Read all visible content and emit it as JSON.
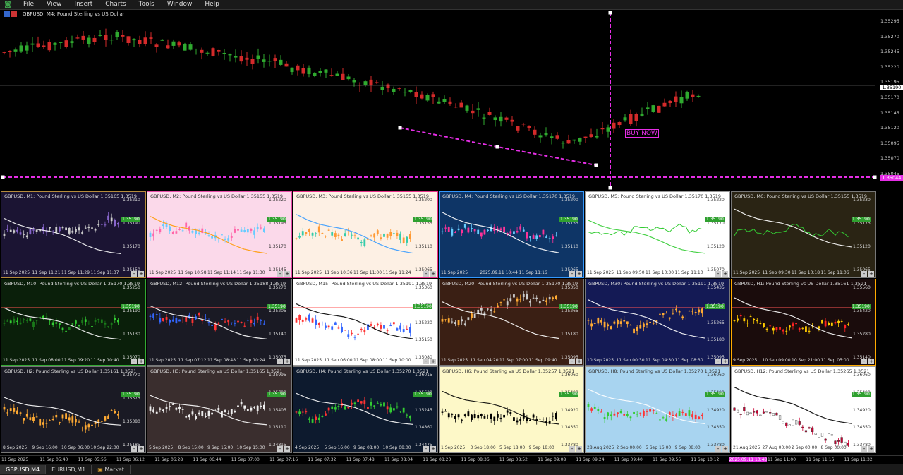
{
  "menu": [
    "File",
    "View",
    "Insert",
    "Charts",
    "Tools",
    "Window",
    "Help"
  ],
  "main_chart": {
    "title": "GBPUSD, M4:  Pound Sterling vs US Dollar",
    "prices": [
      "1.35295",
      "1.35270",
      "1.35245",
      "1.35220",
      "1.35195",
      "1.35170",
      "1.35145",
      "1.35120",
      "1.35095",
      "1.35070",
      "1.35045"
    ],
    "current_price": "1.35190",
    "line_price": "1.35044",
    "label": "BUY NOW"
  },
  "tiles": [
    {
      "title": "GBPUSD, M1:  Pound Sterling vs US Dollar  1.35165 1.3519",
      "bg": "#1b1433",
      "fg": "#ddd",
      "border": "#b58b3c",
      "prices": [
        "1.35210",
        "1.35190",
        "1.35170",
        "1.35150"
      ],
      "cur": "1.35190",
      "times": [
        "11 Sep 2025",
        "11 Sep 11:21",
        "11 Sep 11:29",
        "11 Sep 11:37"
      ],
      "up": "#cccccc",
      "dn": "#8866cc",
      "ma": "#ffffff"
    },
    {
      "title": "GBPUSD, M2:  Pound Sterling vs US Dollar  1.35155 1.3519",
      "bg": "#fbd9ea",
      "fg": "#333",
      "border": "#e64da8",
      "prices": [
        "1.35220",
        "1.35195",
        "1.35170",
        "1.35145"
      ],
      "cur": "1.35190",
      "times": [
        "11 Sep 2025",
        "11 Sep 10:58",
        "11 Sep 11:14",
        "11 Sep 11:30"
      ],
      "up": "#66ccff",
      "dn": "#ff66aa",
      "ma": "#ff9900"
    },
    {
      "title": "GBPUSD, M3:  Pound Sterling vs US Dollar  1.35155 1.3519",
      "bg": "#fdf0e4",
      "fg": "#333",
      "border": "#e8328a",
      "prices": [
        "1.35200",
        "1.35155",
        "1.35110",
        "1.35065"
      ],
      "cur": "1.35190",
      "times": [
        "11 Sep 2025",
        "11 Sep 10:36",
        "11 Sep 11:00",
        "11 Sep 11:24"
      ],
      "up": "#33ccaa",
      "dn": "#ff9933",
      "ma": "#3399ff"
    },
    {
      "title": "GBPUSD, M4:  Pound Sterling vs US Dollar  1.35170 1.3519",
      "bg": "#0e3566",
      "fg": "#ddd",
      "border": "#3399ff",
      "prices": [
        "1.35200",
        "1.35155",
        "1.35110",
        "1.35065"
      ],
      "cur": "1.35190",
      "times": [
        "11 Sep 2025",
        "2025.09.11 10:44",
        "11 Sep 11:16"
      ],
      "up": "#66ccff",
      "dn": "#ff3399",
      "ma": "#ffffff"
    },
    {
      "title": "GBPUSD, M5:  Pound Sterling vs US Dollar  1.35170 1.3519",
      "bg": "#ffffff",
      "fg": "#333",
      "border": "#999",
      "prices": [
        "1.35220",
        "1.35170",
        "1.35120",
        "1.35070"
      ],
      "cur": "1.35190",
      "times": [
        "11 Sep 2025",
        "11 Sep 09:50",
        "11 Sep 10:30",
        "11 Sep 11:10"
      ],
      "up": "#33cc33",
      "dn": "#33cc33",
      "ma": "#33cc33"
    },
    {
      "title": "GBPUSD, M6:  Pound Sterling vs US Dollar  1.35155 1.3519",
      "bg": "#2a2414",
      "fg": "#ddd",
      "border": "#777",
      "prices": [
        "1.35230",
        "1.35175",
        "1.35120",
        "1.35065"
      ],
      "cur": "1.35190",
      "times": [
        "11 Sep 2025",
        "11 Sep 09:30",
        "11 Sep 10:18",
        "11 Sep 11:06"
      ],
      "up": "#33cc33",
      "dn": "#33cc33",
      "ma": "#ffffff"
    },
    {
      "title": "GBPUSD, M10:  Pound Sterling vs US Dollar  1.35170 1.3519",
      "bg": "#0a1f0a",
      "fg": "#ddd",
      "border": "#33aa33",
      "prices": [
        "1.35250",
        "1.35190",
        "1.35130",
        "1.35070"
      ],
      "cur": "1.35190",
      "times": [
        "11 Sep 2025",
        "11 Sep 08:00",
        "11 Sep 09:20",
        "11 Sep 10:40"
      ],
      "up": "#33cc33",
      "dn": "#1a7a1a",
      "ma": "#ffffff"
    },
    {
      "title": "GBPUSD, M12:  Pound Sterling vs US Dollar  1.35188 1.3519",
      "bg": "#1a1a24",
      "fg": "#ddd",
      "border": "#777",
      "prices": [
        "1.35270",
        "1.35205",
        "1.35140",
        "1.35075"
      ],
      "cur": "1.35190",
      "times": [
        "11 Sep 2025",
        "11 Sep 07:12",
        "11 Sep 08:48",
        "11 Sep 10:24"
      ],
      "up": "#3366ff",
      "dn": "#ff3333",
      "ma": "#ffffff"
    },
    {
      "title": "GBPUSD, M15:  Pound Sterling vs US Dollar  1.35191 1.3519",
      "bg": "#ffffff",
      "fg": "#333",
      "border": "#999",
      "prices": [
        "1.35360",
        "1.35290",
        "1.35220",
        "1.35150",
        "1.35080"
      ],
      "cur": "1.35190",
      "times": [
        "11 Sep 2025",
        "11 Sep 06:00",
        "11 Sep 08:00",
        "11 Sep 10:00"
      ],
      "up": "#3366ff",
      "dn": "#ff3333",
      "ma": "#000000"
    },
    {
      "title": "GBPUSD, M20:  Pound Sterling vs US Dollar  1.35170 1.3519",
      "bg": "#3a1f14",
      "fg": "#ddd",
      "border": "#777",
      "prices": [
        "1.35350",
        "1.35265",
        "1.35180",
        "1.35095"
      ],
      "cur": "1.35190",
      "times": [
        "11 Sep 2025",
        "11 Sep 04:20",
        "11 Sep 07:00",
        "11 Sep 09:40"
      ],
      "up": "#cccccc",
      "dn": "#ffaa33",
      "ma": "#ffffff"
    },
    {
      "title": "GBPUSD, M30:  Pound Sterling vs US Dollar  1.35191 1.3519",
      "bg": "#141a55",
      "fg": "#ddd",
      "border": "#777",
      "prices": [
        "1.35435",
        "1.35350",
        "1.35265",
        "1.35180",
        "1.35095"
      ],
      "cur": "1.35190",
      "times": [
        "10 Sep 2025",
        "11 Sep 00:30",
        "11 Sep 04:30",
        "11 Sep 08:30"
      ],
      "up": "#ffaa33",
      "dn": "#ffaa33",
      "ma": "#ffffff"
    },
    {
      "title": "GBPUSD, H1:  Pound Sterling vs US Dollar  1.35161 1.3521",
      "bg": "#1a0c0c",
      "fg": "#ddd",
      "border": "#ffaa00",
      "prices": [
        "1.35560",
        "1.35420",
        "1.35280",
        "1.35140"
      ],
      "cur": "1.35190",
      "times": [
        "9 Sep 2025",
        "10 Sep 09:00",
        "10 Sep 21:00",
        "11 Sep 05:00"
      ],
      "up": "#ffcc00",
      "dn": "#ff2222",
      "ma": "#ffffff"
    },
    {
      "title": "GBPUSD, H2:  Pound Sterling vs US Dollar  1.35161 1.3521",
      "bg": "#1a1a24",
      "fg": "#ddd",
      "border": "#777",
      "prices": [
        "1.35770",
        "1.35575",
        "1.35380",
        "1.35185"
      ],
      "cur": "1.35190",
      "times": [
        "8 Sep 2025",
        "9 Sep 16:00",
        "10 Sep 06:00",
        "10 Sep 22:00"
      ],
      "up": "#ffaa33",
      "dn": "#ffaa33",
      "ma": "#ffffff"
    },
    {
      "title": "GBPUSD, H3:  Pound Sterling vs US Dollar  1.35165 1.3521",
      "bg": "#3a2e2e",
      "fg": "#ddd",
      "border": "#777",
      "prices": [
        "1.35995",
        "1.35700",
        "1.35405",
        "1.35110",
        "1.34815"
      ],
      "cur": "1.35190",
      "times": [
        "5 Sep 2025",
        "8 Sep 15:00",
        "9 Sep 15:00",
        "10 Sep 15:00"
      ],
      "up": "#eeeeee",
      "dn": "#eeeeee",
      "ma": "#ffffff"
    },
    {
      "title": "GBPUSD, H4:  Pound Sterling vs US Dollar  1.35270 1.3521",
      "bg": "#0d1a2e",
      "fg": "#ddd",
      "border": "#777",
      "prices": [
        "1.36015",
        "1.35630",
        "1.35245",
        "1.34860",
        "1.34475"
      ],
      "cur": "1.35190",
      "times": [
        "4 Sep 2025",
        "5 Sep 16:00",
        "9 Sep 08:00",
        "10 Sep 08:00"
      ],
      "up": "#33cc33",
      "dn": "#ff3333",
      "ma": "#ffffff"
    },
    {
      "title": "GBPUSD, H6:  Pound Sterling vs US Dollar  1.35257 1.3521",
      "bg": "#fdf8c8",
      "fg": "#333",
      "border": "#999",
      "prices": [
        "1.36060",
        "1.35490",
        "1.34920",
        "1.34350",
        "1.33780"
      ],
      "cur": "1.35190",
      "times": [
        "1 Sep 2025",
        "3 Sep 18:00",
        "5 Sep 18:00",
        "9 Sep 18:00"
      ],
      "up": "#000000",
      "dn": "#000000",
      "ma": "#000000"
    },
    {
      "title": "GBPUSD, H8:  Pound Sterling vs US Dollar  1.35270 1.3521",
      "bg": "#a8d4f0",
      "fg": "#333",
      "border": "#999",
      "prices": [
        "1.36060",
        "1.35490",
        "1.34920",
        "1.34350",
        "1.33780"
      ],
      "cur": "1.35190",
      "times": [
        "28 Aug 2025",
        "2 Sep 00:00",
        "5 Sep 16:00",
        "9 Sep 08:00"
      ],
      "up": "#33cc33",
      "dn": "#ff3333",
      "ma": "#ffffff"
    },
    {
      "title": "GBPUSD, H12:  Pound Sterling vs US Dollar  1.35265 1.3521",
      "bg": "#ffffff",
      "fg": "#333",
      "border": "#999",
      "prices": [
        "1.36060",
        "1.35490",
        "1.34920",
        "1.34350",
        "1.33780"
      ],
      "cur": "1.35190",
      "times": [
        "21 Aug 2025",
        "27 Aug 00:00",
        "2 Sep 00:00",
        "8 Sep 00:00"
      ],
      "up": "#ffffff",
      "dn": "#cc0033",
      "ma": "#000000"
    }
  ],
  "timeline": [
    "11 Sep 2025",
    "11 Sep 05:40",
    "11 Sep 05:56",
    "11 Sep 06:12",
    "11 Sep 06:28",
    "11 Sep 06:44",
    "11 Sep 07:00",
    "11 Sep 07:16",
    "11 Sep 07:32",
    "11 Sep 07:48",
    "11 Sep 08:04",
    "11 Sep 08:20",
    "11 Sep 08:36",
    "11 Sep 08:52",
    "11 Sep 09:08",
    "11 Sep 09:24",
    "11 Sep 09:40",
    "11 Sep 09:56",
    "11 Sep 10:12",
    "2025.09.11 10:48",
    "11 Sep 11:00",
    "11 Sep 11:16",
    "11 Sep 11:32"
  ],
  "tabs": [
    "GBPUSD,M4",
    "EURUSD,M1",
    "Market"
  ],
  "colors": {
    "accent": "#e62ee6",
    "bull": "#2faa2f",
    "bear": "#d42a2a"
  }
}
